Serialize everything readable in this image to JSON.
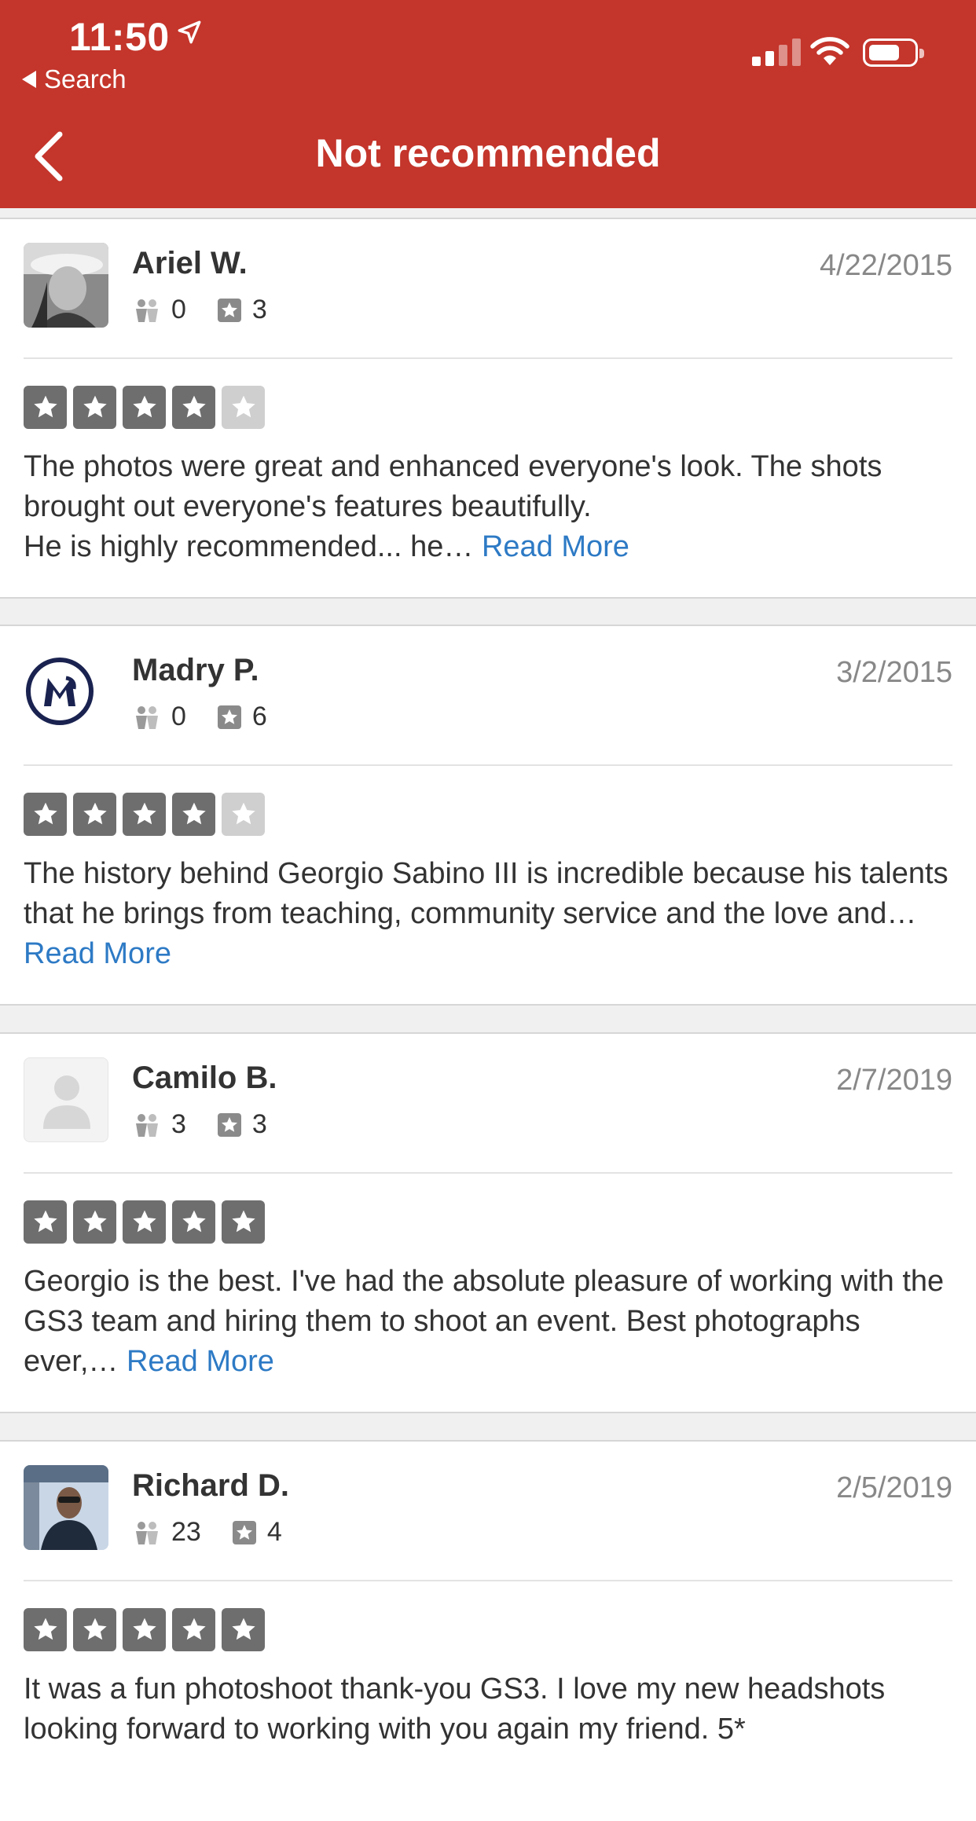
{
  "status_bar": {
    "time": "11:50",
    "back_app": "Search"
  },
  "nav": {
    "title": "Not recommended"
  },
  "colors": {
    "header": "#c4352b",
    "star_filled": "#6e6e6e",
    "star_empty": "#cfcfcf",
    "link": "#2d7ac5"
  },
  "reviews": [
    {
      "name": "Ariel W.",
      "date": "4/22/2015",
      "friends": "0",
      "reviews": "3",
      "rating": 4,
      "text": "The photos were great and enhanced everyone's look. The shots brought out everyone's features beautifully.\nHe is highly recommended... he…",
      "read_more": "Read More",
      "avatar": "photo"
    },
    {
      "name": "Madry P.",
      "date": "3/2/2015",
      "friends": "0",
      "reviews": "6",
      "rating": 4,
      "text": "The history behind Georgio Sabino III is incredible because his talents that he brings from teaching, community service and the love and…",
      "read_more": "Read More",
      "avatar": "logo-m"
    },
    {
      "name": "Camilo B.",
      "date": "2/7/2019",
      "friends": "3",
      "reviews": "3",
      "rating": 5,
      "text": "Georgio is the best. I've had the absolute pleasure of working with the GS3 team and hiring them to shoot an event. Best photographs ever,…",
      "read_more": "Read More",
      "avatar": "placeholder"
    },
    {
      "name": "Richard D.",
      "date": "2/5/2019",
      "friends": "23",
      "reviews": "4",
      "rating": 5,
      "text": "It was a fun photoshoot thank-you GS3. I love my new headshots looking forward to working with you again my friend. 5*",
      "read_more": "",
      "avatar": "photo-2"
    }
  ]
}
